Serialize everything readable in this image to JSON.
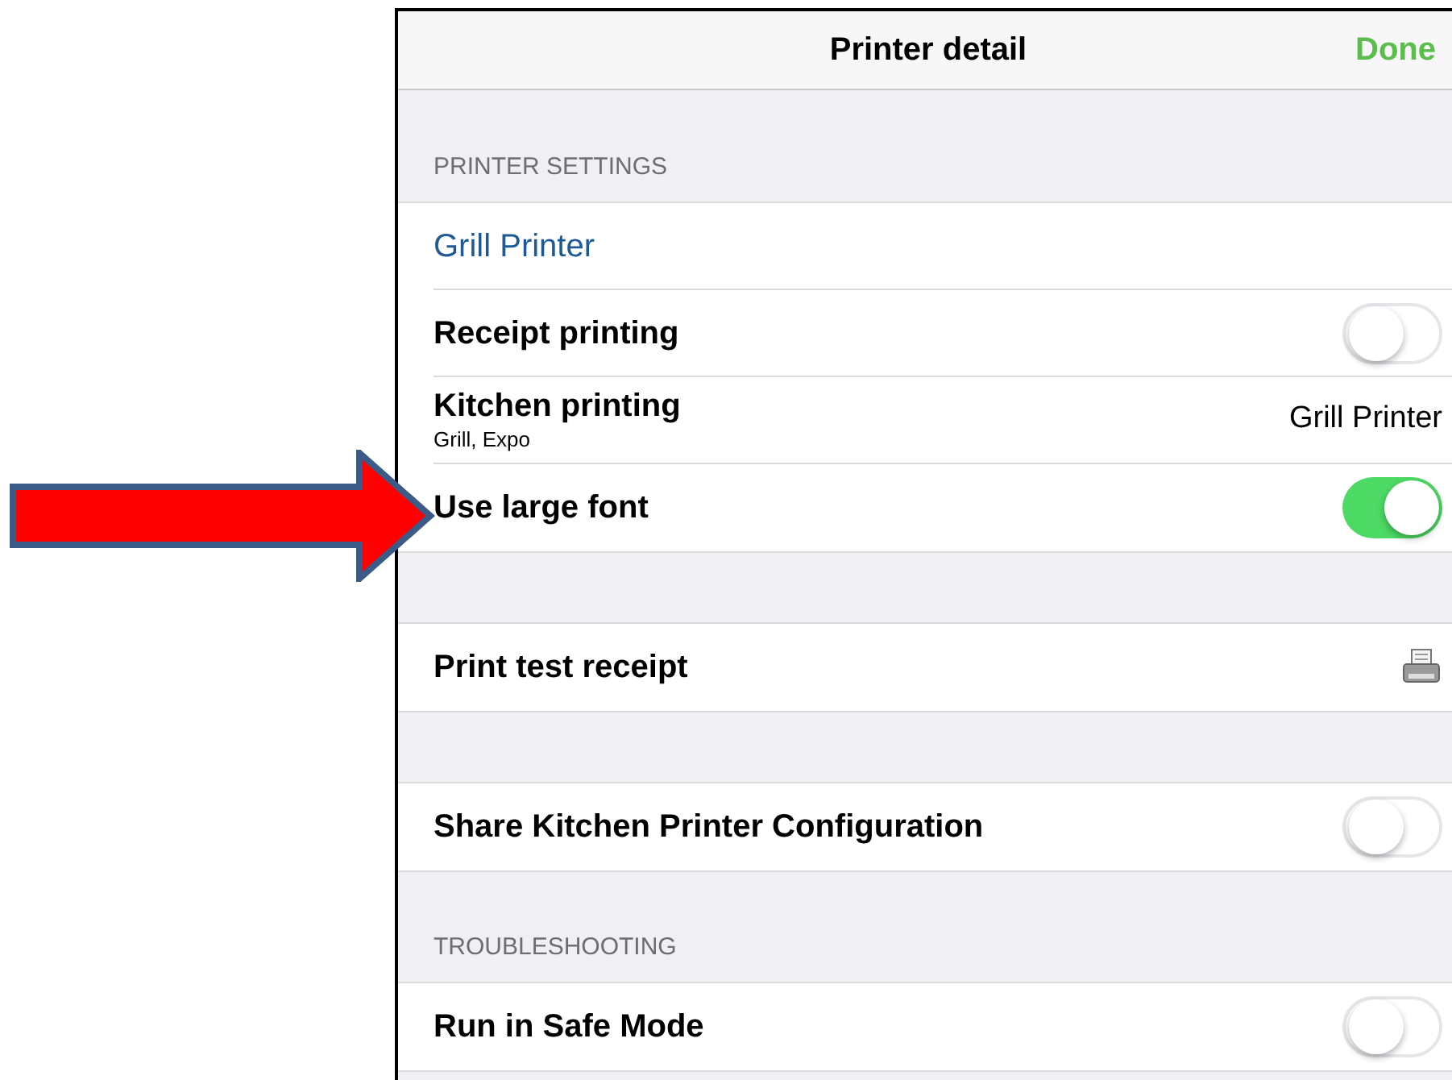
{
  "nav_bar": {
    "title": "Printer detail",
    "done": "Done"
  },
  "sections": [
    {
      "header": "PRINTER SETTINGS",
      "rows": [
        {
          "kind": "link",
          "label": "Grill Printer"
        },
        {
          "kind": "toggle",
          "label": "Receipt printing",
          "on": false
        },
        {
          "kind": "detail",
          "label": "Kitchen printing",
          "subtitle": "Grill, Expo",
          "value": "Grill Printer"
        },
        {
          "kind": "toggle",
          "label": "Use large font",
          "on": true
        }
      ]
    },
    {
      "rows": [
        {
          "kind": "action",
          "label": "Print test receipt"
        }
      ]
    },
    {
      "rows": [
        {
          "kind": "toggle",
          "label": "Share Kitchen Printer Configuration",
          "on": false
        }
      ]
    },
    {
      "header": "TROUBLESHOOTING",
      "rows": [
        {
          "kind": "toggle",
          "label": "Run in Safe Mode",
          "on": false
        }
      ]
    }
  ]
}
